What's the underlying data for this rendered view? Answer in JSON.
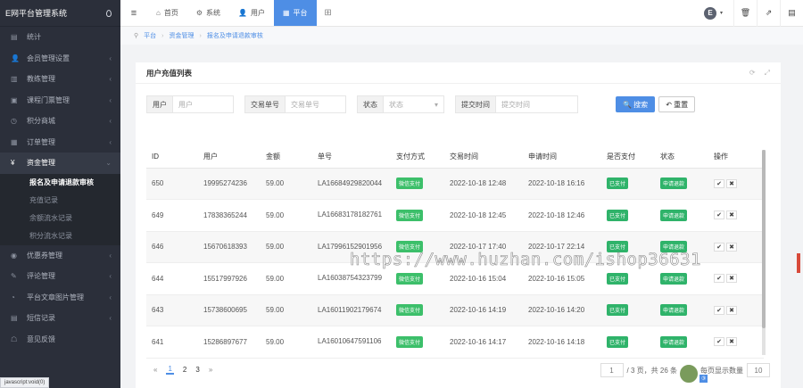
{
  "brand": {
    "title": "E网平台管理系统"
  },
  "sidebar": {
    "items": [
      {
        "icon": "▤",
        "label": "统计",
        "arrow": ""
      },
      {
        "icon": "👤",
        "label": "会员管理设置",
        "arrow": "‹"
      },
      {
        "icon": "▥",
        "label": "教练管理",
        "arrow": "‹"
      },
      {
        "icon": "▣",
        "label": "课程门票管理",
        "arrow": "‹"
      },
      {
        "icon": "◷",
        "label": "积分商城",
        "arrow": "‹"
      },
      {
        "icon": "▦",
        "label": "订单管理",
        "arrow": "‹"
      },
      {
        "icon": "¥",
        "label": "资金管理",
        "arrow": "⌄"
      }
    ],
    "subitems": [
      {
        "label": "报名及申请退款审核",
        "current": true
      },
      {
        "label": "充值记录",
        "current": false
      },
      {
        "label": "余额流水记录",
        "current": false
      },
      {
        "label": "积分流水记录",
        "current": false
      }
    ],
    "items_after": [
      {
        "icon": "◉",
        "label": "优惠券管理",
        "arrow": "‹"
      },
      {
        "icon": "✎",
        "label": "评论管理",
        "arrow": "‹"
      },
      {
        "icon": "◔",
        "label": "平台文章图片管理",
        "arrow": "‹"
      },
      {
        "icon": "▤",
        "label": "短信记录",
        "arrow": "‹"
      },
      {
        "icon": "☖",
        "label": "意见反馈",
        "arrow": ""
      }
    ],
    "status_url": "javascript:void(0)"
  },
  "topbar": {
    "menu_icon": "≡",
    "tabs": [
      {
        "icon": "⌂",
        "label": "首页",
        "active": false
      },
      {
        "icon": "⚙",
        "label": "系统",
        "active": false
      },
      {
        "icon": "👤",
        "label": "用户",
        "active": false
      },
      {
        "icon": "▦",
        "label": "平台",
        "active": true
      }
    ],
    "grid_icon": "⊞",
    "avatar_letter": "E",
    "caret": "▾",
    "icon_buttons": [
      "🗑",
      "⇗",
      "▤"
    ]
  },
  "breadcrumb": {
    "home_icon": "⚲",
    "items": [
      "平台",
      "资金管理",
      "报名及申请退款审核"
    ]
  },
  "panel": {
    "title": "用户充值列表",
    "tools": [
      "⟳",
      "⤢"
    ]
  },
  "filters": {
    "user_label": "用户",
    "user_placeholder": "用户",
    "order_label": "交易单号",
    "order_placeholder": "交易单号",
    "status_label": "状态",
    "status_placeholder": "状态",
    "time_label": "提交时间",
    "time_placeholder": "提交时间",
    "search_label": "🔍 搜索",
    "reset_label": "↶ 重置"
  },
  "table": {
    "headers": [
      "ID",
      "用户",
      "金额",
      "单号",
      "支付方式",
      "交易时间",
      "申请时间",
      "是否支付",
      "状态",
      "操作"
    ],
    "rows": [
      {
        "id": "650",
        "user": "19995274236",
        "amount": "59.00",
        "order": "LA16684929820044",
        "pay": "微信支付",
        "trade_time": "2022-10-18 12:48",
        "apply_time": "2022-10-18 16:16",
        "paid": "已支付",
        "status": "申请退款"
      },
      {
        "id": "649",
        "user": "17838365244",
        "amount": "59.00",
        "order": "LA16683178182761",
        "pay": "微信支付",
        "trade_time": "2022-10-18 12:45",
        "apply_time": "2022-10-18 12:46",
        "paid": "已支付",
        "status": "申请退款"
      },
      {
        "id": "646",
        "user": "15670618393",
        "amount": "59.00",
        "order": "LA17996152901956",
        "pay": "微信支付",
        "trade_time": "2022-10-17 17:40",
        "apply_time": "2022-10-17 22:14",
        "paid": "已支付",
        "status": "申请退款"
      },
      {
        "id": "644",
        "user": "15517997926",
        "amount": "59.00",
        "order": "LA16038754323799",
        "pay": "微信支付",
        "trade_time": "2022-10-16 15:04",
        "apply_time": "2022-10-16 15:05",
        "paid": "已支付",
        "status": "申请退款"
      },
      {
        "id": "643",
        "user": "15738600695",
        "amount": "59.00",
        "order": "LA16011902179674",
        "pay": "微信支付",
        "trade_time": "2022-10-16 14:19",
        "apply_time": "2022-10-16 14:20",
        "paid": "已支付",
        "status": "申请退款"
      },
      {
        "id": "641",
        "user": "15286897677",
        "amount": "59.00",
        "order": "LA16010647591106",
        "pay": "微信支付",
        "trade_time": "2022-10-16 14:17",
        "apply_time": "2022-10-16 14:18",
        "paid": "已支付",
        "status": "申请退款"
      }
    ],
    "op_approve": "✔",
    "op_reject": "✖"
  },
  "pager": {
    "prev": "«",
    "pages": [
      "1",
      "2",
      "3"
    ],
    "next": "»",
    "goto_value": "1",
    "summary": "/ 3 页，共 26 条",
    "per_page_label": "每页显示数量",
    "per_page_value": "10"
  },
  "overlays": {
    "watermark": "https://www.huzhan.com/ishop36631",
    "badge": "③"
  },
  "colors": {
    "accent": "#4e8ee5",
    "sidebar_bg": "#2b2f3a",
    "tag_green": "#2fb36a"
  }
}
